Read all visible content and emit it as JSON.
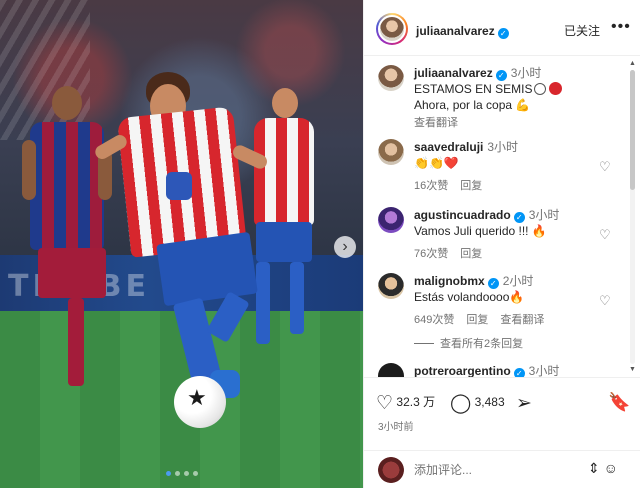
{
  "post": {
    "author": "juliaanalvarez",
    "follow_state": "已关注",
    "more_label": "•••",
    "carousel_next": "›",
    "billboard_text": "TEA  BE"
  },
  "caption": {
    "username": "juliaanalvarez",
    "time": "3小时",
    "line1": "ESTAMOS EN SEMIS",
    "line2": "Ahora, por la copa 💪",
    "translate": "查看翻译"
  },
  "comments": [
    {
      "username": "saavedraluji",
      "verified": false,
      "time": "3小时",
      "text": "👏👏❤️",
      "likes": "16次赞",
      "reply": "回复",
      "translate": ""
    },
    {
      "username": "agustincuadrado",
      "verified": true,
      "time": "3小时",
      "text": "Vamos Juli querido !!! 🔥",
      "likes": "76次赞",
      "reply": "回复",
      "translate": ""
    },
    {
      "username": "malignobmx",
      "verified": true,
      "time": "2小时",
      "text": "Estás volandoooo🔥",
      "likes": "649次赞",
      "reply": "回复",
      "translate": "查看翻译"
    },
    {
      "username": "potreroargentino",
      "verified": true,
      "time": "3小时",
      "text": "",
      "likes": "",
      "reply": "",
      "translate": ""
    }
  ],
  "view_replies": "查看所有2条回复",
  "actions": {
    "likes": "32.3 万",
    "comments": "3,483",
    "posted": "3小时前"
  },
  "add_comment": {
    "placeholder": "添加评论..."
  },
  "icons": {
    "heart": "heart-icon",
    "comment": "comment-icon",
    "share": "share-icon",
    "bookmark": "bookmark-icon",
    "emoji": "emoji-icon"
  },
  "colors": {
    "verified": "#0095f6",
    "text": "#262626",
    "muted": "#737373",
    "carousel_active": "#4c9bf0"
  }
}
